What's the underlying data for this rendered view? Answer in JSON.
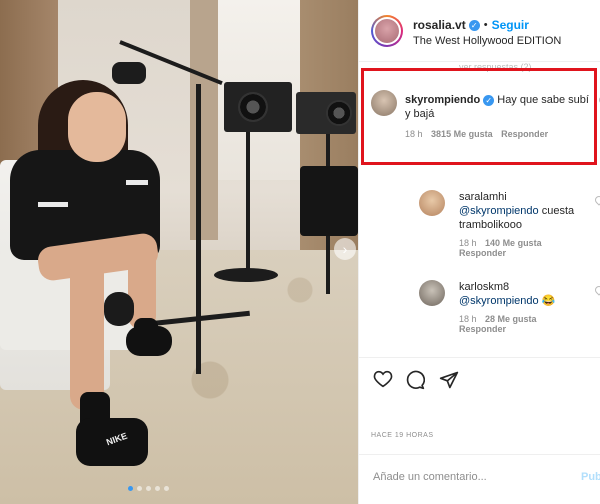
{
  "header": {
    "username": "rosalia.vt",
    "separator": "•",
    "follow_label": "Seguir",
    "location": "The West Hollywood EDITION"
  },
  "faded_row": "ver respuestas (2)",
  "highlighted_comment": {
    "username": "skyrompiendo",
    "text": "Hay que sabe subí y bajá",
    "time": "18 h",
    "likes": "3815 Me gusta",
    "reply": "Responder"
  },
  "replies": [
    {
      "username": "saralamhi",
      "mention": "@skyrompiendo",
      "text": " cuesta trambolikooo",
      "time": "18 h",
      "likes": "140 Me gusta",
      "reply": "Responder"
    },
    {
      "username": "karloskm8",
      "mention": "@skyrompiendo",
      "text": " 😂",
      "time": "18 h",
      "likes": "28 Me gusta",
      "reply": "Responder"
    }
  ],
  "timestamp": "HACE 19 HORAS",
  "comment_box": {
    "placeholder": "Añade un comentario...",
    "publish": "Publ"
  },
  "colors": {
    "accent": "#0095f6",
    "highlight": "#e0141d",
    "verified": "#3897f0"
  },
  "icons": [
    "heart-icon",
    "comment-icon",
    "share-icon",
    "verified-badge-icon"
  ]
}
